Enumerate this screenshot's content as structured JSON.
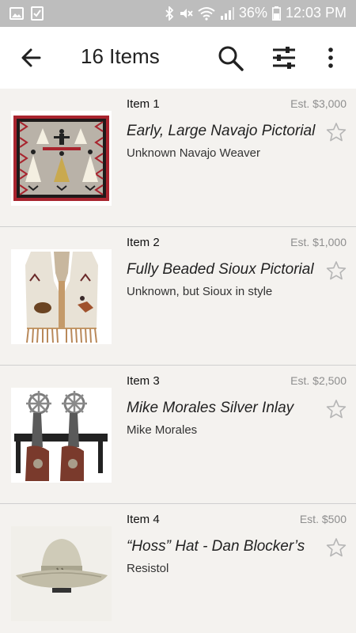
{
  "status_bar": {
    "battery": "36%",
    "time": "12:03 PM",
    "icons": [
      "image-icon",
      "checkbox-icon",
      "bluetooth-icon",
      "mute-icon",
      "wifi-icon",
      "signal-icon",
      "battery-icon"
    ]
  },
  "toolbar": {
    "title": "16 Items",
    "icons": [
      "back-arrow-icon",
      "search-icon",
      "filter-sliders-icon",
      "more-vert-icon"
    ]
  },
  "items": [
    {
      "lot": "Item 1",
      "estimate": "Est. $3,000",
      "name": "Early, Large Navajo Pictorial",
      "maker": "Unknown Navajo Weaver",
      "favorited": false
    },
    {
      "lot": "Item 2",
      "estimate": "Est. $1,000",
      "name": "Fully Beaded Sioux Pictorial",
      "maker": "Unknown, but Sioux in style",
      "favorited": false
    },
    {
      "lot": "Item 3",
      "estimate": "Est. $2,500",
      "name": "Mike Morales Silver Inlay",
      "maker": "Mike Morales",
      "favorited": false
    },
    {
      "lot": "Item 4",
      "estimate": "Est. $500",
      "name": "“Hoss” Hat - Dan Blocker’s",
      "maker": "Resistol",
      "favorited": false
    }
  ],
  "colors": {
    "status_bar": "#bdbdbd",
    "toolbar": "#ffffff",
    "list_bg": "#f4f2ef",
    "star": "#b5b5b5"
  }
}
